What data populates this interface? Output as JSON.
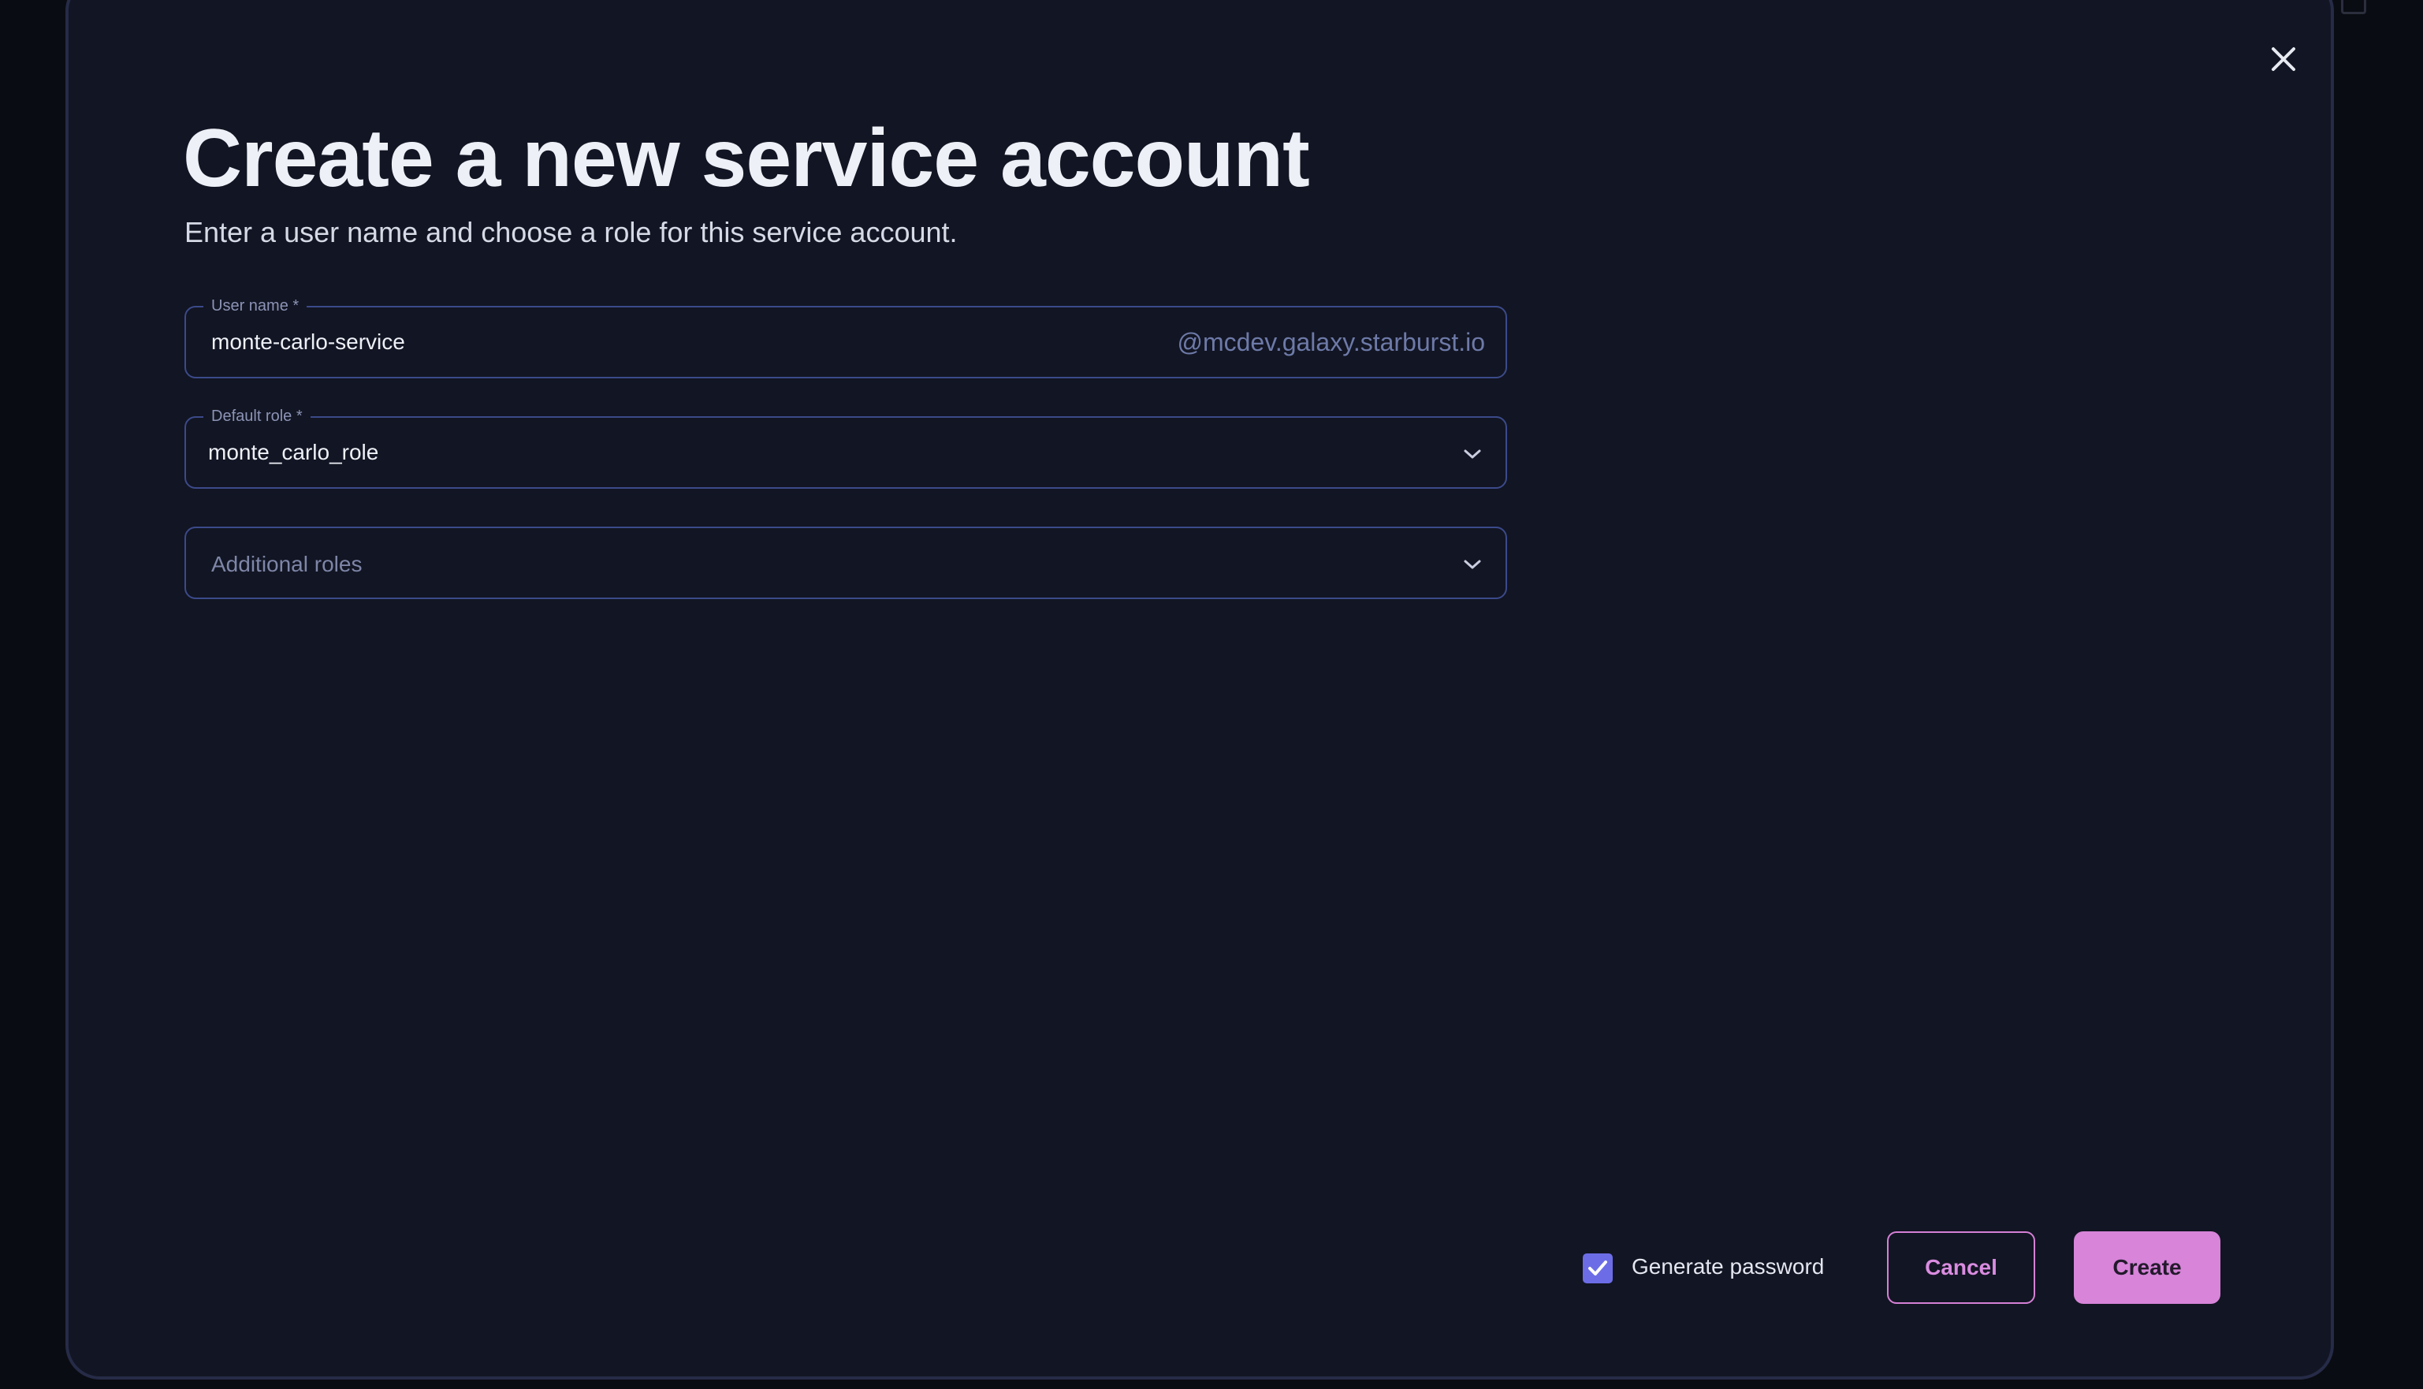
{
  "dialog": {
    "title": "Create a new service account",
    "subtitle": "Enter a user name and choose a role for this service account."
  },
  "form": {
    "user_name": {
      "label": "User name *",
      "value": "monte-carlo-service",
      "suffix": "@mcdev.galaxy.starburst.io"
    },
    "default_role": {
      "label": "Default role *",
      "value": "monte_carlo_role"
    },
    "additional_roles": {
      "placeholder": "Additional roles"
    }
  },
  "footer": {
    "generate_password_label": "Generate password",
    "generate_password_checked": true,
    "cancel_label": "Cancel",
    "create_label": "Create"
  },
  "icons": {
    "close": "close-icon",
    "chevron": "chevron-down-icon",
    "check": "check-icon"
  },
  "colors": {
    "modal_bg": "#121523",
    "field_border": "#3b4a8a",
    "accent_pink": "#d784d9",
    "checkbox_purple": "#6c6de6"
  }
}
